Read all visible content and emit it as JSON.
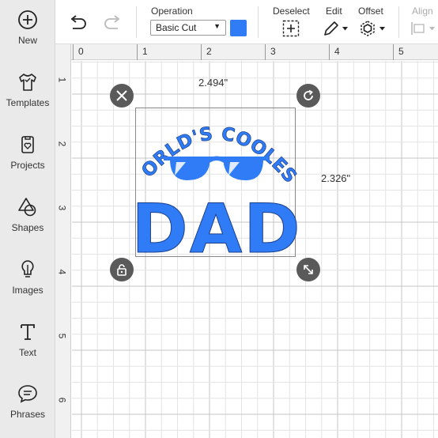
{
  "sidebar": {
    "items": [
      {
        "label": "New",
        "icon": "plus-circle-icon"
      },
      {
        "label": "Templates",
        "icon": "tshirt-icon"
      },
      {
        "label": "Projects",
        "icon": "projects-icon"
      },
      {
        "label": "Shapes",
        "icon": "shapes-icon"
      },
      {
        "label": "Images",
        "icon": "lightbulb-icon"
      },
      {
        "label": "Text",
        "icon": "text-icon"
      },
      {
        "label": "Phrases",
        "icon": "speech-bubble-icon"
      }
    ]
  },
  "toolbar": {
    "operation_label": "Operation",
    "operation_value": "Basic Cut",
    "operation_color": "#2f7cf6",
    "deselect_label": "Deselect",
    "edit_label": "Edit",
    "offset_label": "Offset",
    "align_label": "Align"
  },
  "ruler": {
    "top": [
      "0",
      "1",
      "2",
      "3",
      "4",
      "5"
    ],
    "left": [
      "1",
      "2",
      "3",
      "4",
      "5",
      "6"
    ]
  },
  "selection": {
    "width": "2.494\"",
    "height": "2.326\""
  },
  "design": {
    "arc_text": "WORLD'S COOLEST",
    "main_text": "DAD",
    "color": "#2f7cf6"
  }
}
